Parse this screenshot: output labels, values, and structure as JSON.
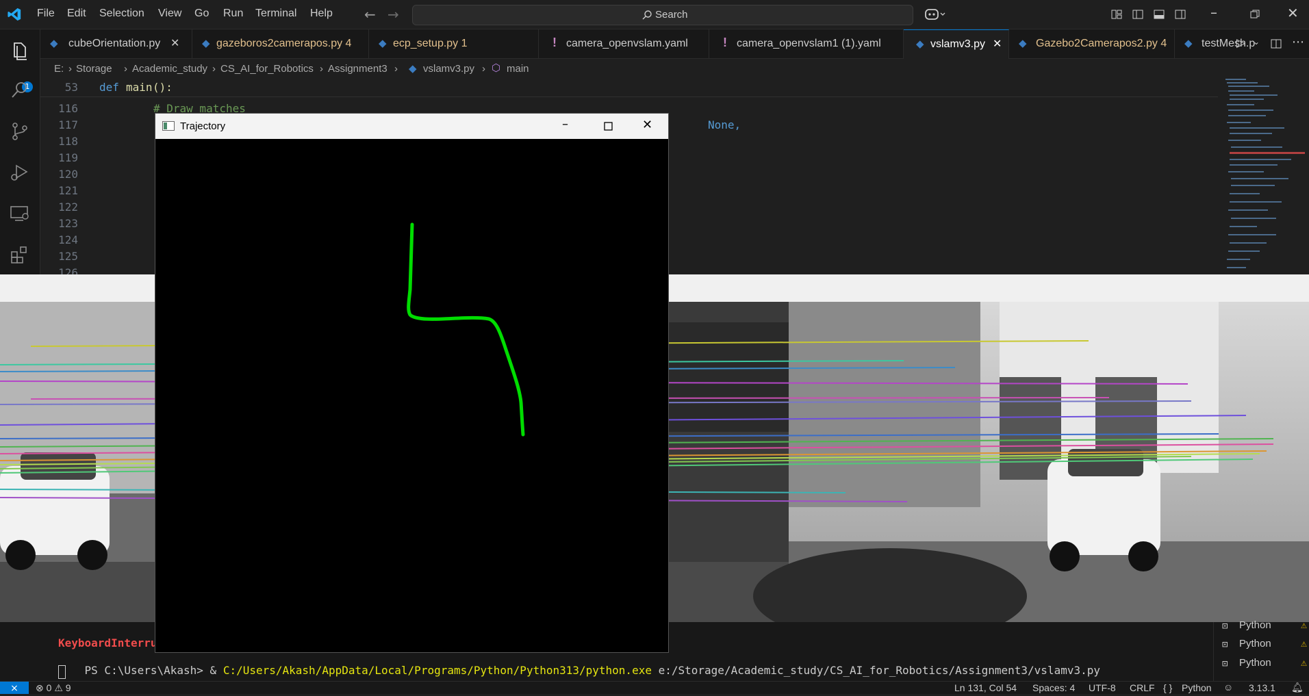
{
  "menu": [
    "File",
    "Edit",
    "Selection",
    "View",
    "Go",
    "Run",
    "Terminal",
    "Help"
  ],
  "search": {
    "label": "Search"
  },
  "activity": {
    "explorer_badge": "1"
  },
  "tabs": [
    {
      "label": "cubeOrientation.py",
      "color": "#cccccc",
      "icon": "python-icon",
      "close": true
    },
    {
      "label": "gazeboros2camerapos.py 4",
      "color": "#e2c08d",
      "icon": "python-icon"
    },
    {
      "label": "ecp_setup.py 1",
      "color": "#e2c08d",
      "icon": "python-icon"
    },
    {
      "label": "camera_openvslam.yaml",
      "color": "#cccccc",
      "icon": "yaml-icon"
    },
    {
      "label": "camera_openvslam1 (1).yaml",
      "color": "#cccccc",
      "icon": "yaml-icon"
    },
    {
      "label": "vslamv3.py",
      "color": "#ffffff",
      "icon": "python-icon",
      "close": true,
      "active": true
    },
    {
      "label": "Gazebo2Camerapos2.py 4",
      "color": "#e2c08d",
      "icon": "python-icon"
    },
    {
      "label": "testMesh.p",
      "color": "#cccccc",
      "icon": "python-icon"
    }
  ],
  "breadcrumb": [
    "E:",
    "Storage",
    "Academic_study",
    "CS_AI_for_Robotics",
    "Assignment3",
    "vslamv3.py",
    "main"
  ],
  "editor": {
    "sticky": {
      "line": "53",
      "kw": "def",
      "fn": "main",
      "rest": "():"
    },
    "lines": [
      {
        "n": "116",
        "text": "# Draw matches",
        "kind": "comment"
      },
      {
        "n": "117",
        "text": "None,",
        "kind": "partial"
      },
      {
        "n": "118",
        "text": ""
      },
      {
        "n": "119",
        "text": ""
      },
      {
        "n": "120",
        "text": ""
      },
      {
        "n": "121",
        "text": ""
      },
      {
        "n": "122",
        "text": ""
      },
      {
        "n": "123",
        "text": ""
      },
      {
        "n": "124",
        "text": ""
      },
      {
        "n": "125",
        "text": ""
      },
      {
        "n": "126",
        "text": ""
      }
    ]
  },
  "trajectory_window": {
    "title": "Trajectory",
    "path_color": "#00dd00"
  },
  "terminal": {
    "error_line": "KeyboardInterrup",
    "prompt": "PS C:\\Users\\Akash> & ",
    "exe": "C:/Users/Akash/AppData/Local/Programs/Python/Python313/python.exe",
    "arg": " e:/Storage/Academic_study/CS_AI_for_Robotics/Assignment3/vslamv3.py",
    "sessions": [
      "Python",
      "Python",
      "Python"
    ]
  },
  "status": {
    "errors": "0",
    "warnings": "9",
    "position": "Ln 131, Col 54",
    "spaces": "Spaces: 4",
    "encoding": "UTF-8",
    "eol": "CRLF",
    "language": "Python",
    "version": "3.13.1"
  }
}
